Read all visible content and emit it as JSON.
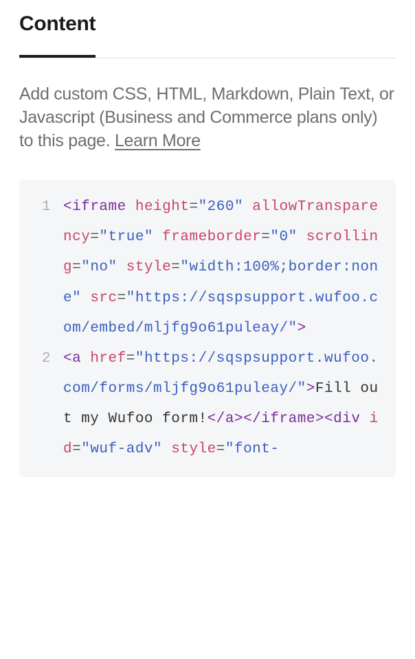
{
  "tabs": {
    "content": "Content"
  },
  "description": {
    "text": "Add custom CSS, HTML, Markdown, Plain Text, or Javascript (Business and Commerce plans only) to this page. ",
    "learn_more": "Learn More"
  },
  "code": {
    "lines": [
      {
        "num": "1",
        "tokens": [
          {
            "type": "punct",
            "text": "<"
          },
          {
            "type": "tag",
            "text": "iframe"
          },
          {
            "type": "space",
            "text": " "
          },
          {
            "type": "attr-name",
            "text": "height"
          },
          {
            "type": "attr-eq",
            "text": "="
          },
          {
            "type": "attr-value",
            "text": "\"260\""
          },
          {
            "type": "space",
            "text": " "
          },
          {
            "type": "attr-name",
            "text": "allowTransparency"
          },
          {
            "type": "attr-eq",
            "text": "="
          },
          {
            "type": "attr-value",
            "text": "\"true\""
          },
          {
            "type": "space",
            "text": " "
          },
          {
            "type": "attr-name",
            "text": "frameborder"
          },
          {
            "type": "attr-eq",
            "text": "="
          },
          {
            "type": "attr-value",
            "text": "\"0\""
          },
          {
            "type": "space",
            "text": " "
          },
          {
            "type": "attr-name",
            "text": "scrolling"
          },
          {
            "type": "attr-eq",
            "text": "="
          },
          {
            "type": "attr-value",
            "text": "\"no\""
          },
          {
            "type": "space",
            "text": " "
          },
          {
            "type": "attr-name",
            "text": "style"
          },
          {
            "type": "attr-eq",
            "text": "="
          },
          {
            "type": "attr-value",
            "text": "\"width:100%;border:none\""
          },
          {
            "type": "space",
            "text": " "
          },
          {
            "type": "attr-name",
            "text": "src"
          },
          {
            "type": "attr-eq",
            "text": "="
          },
          {
            "type": "attr-value",
            "text": "\"https://sqspsupport.wufoo.com/embed/mljfg9o61puleay/\""
          },
          {
            "type": "punct",
            "text": ">"
          }
        ]
      },
      {
        "num": "2",
        "tokens": [
          {
            "type": "indent",
            "text": "  "
          },
          {
            "type": "punct",
            "text": "<"
          },
          {
            "type": "tag",
            "text": "a"
          },
          {
            "type": "space",
            "text": " "
          },
          {
            "type": "attr-name",
            "text": "href"
          },
          {
            "type": "attr-eq",
            "text": "="
          },
          {
            "type": "attr-value",
            "text": "\"https://sqspsupport.wufoo.com/forms/mljfg9o61puleay/\""
          },
          {
            "type": "punct",
            "text": ">"
          },
          {
            "type": "text-content",
            "text": "Fill out my Wufoo form!"
          },
          {
            "type": "punct",
            "text": "</"
          },
          {
            "type": "tag",
            "text": "a"
          },
          {
            "type": "punct",
            "text": ">"
          },
          {
            "type": "punct",
            "text": "</"
          },
          {
            "type": "tag",
            "text": "iframe"
          },
          {
            "type": "punct",
            "text": ">"
          },
          {
            "type": "punct",
            "text": "<"
          },
          {
            "type": "tag",
            "text": "div"
          },
          {
            "type": "space",
            "text": " "
          },
          {
            "type": "attr-name",
            "text": "id"
          },
          {
            "type": "attr-eq",
            "text": "="
          },
          {
            "type": "attr-value",
            "text": "\"wuf-adv\""
          },
          {
            "type": "space",
            "text": " "
          },
          {
            "type": "attr-name",
            "text": "style"
          },
          {
            "type": "attr-eq",
            "text": "="
          },
          {
            "type": "attr-value",
            "text": "\"font-"
          }
        ]
      }
    ]
  }
}
